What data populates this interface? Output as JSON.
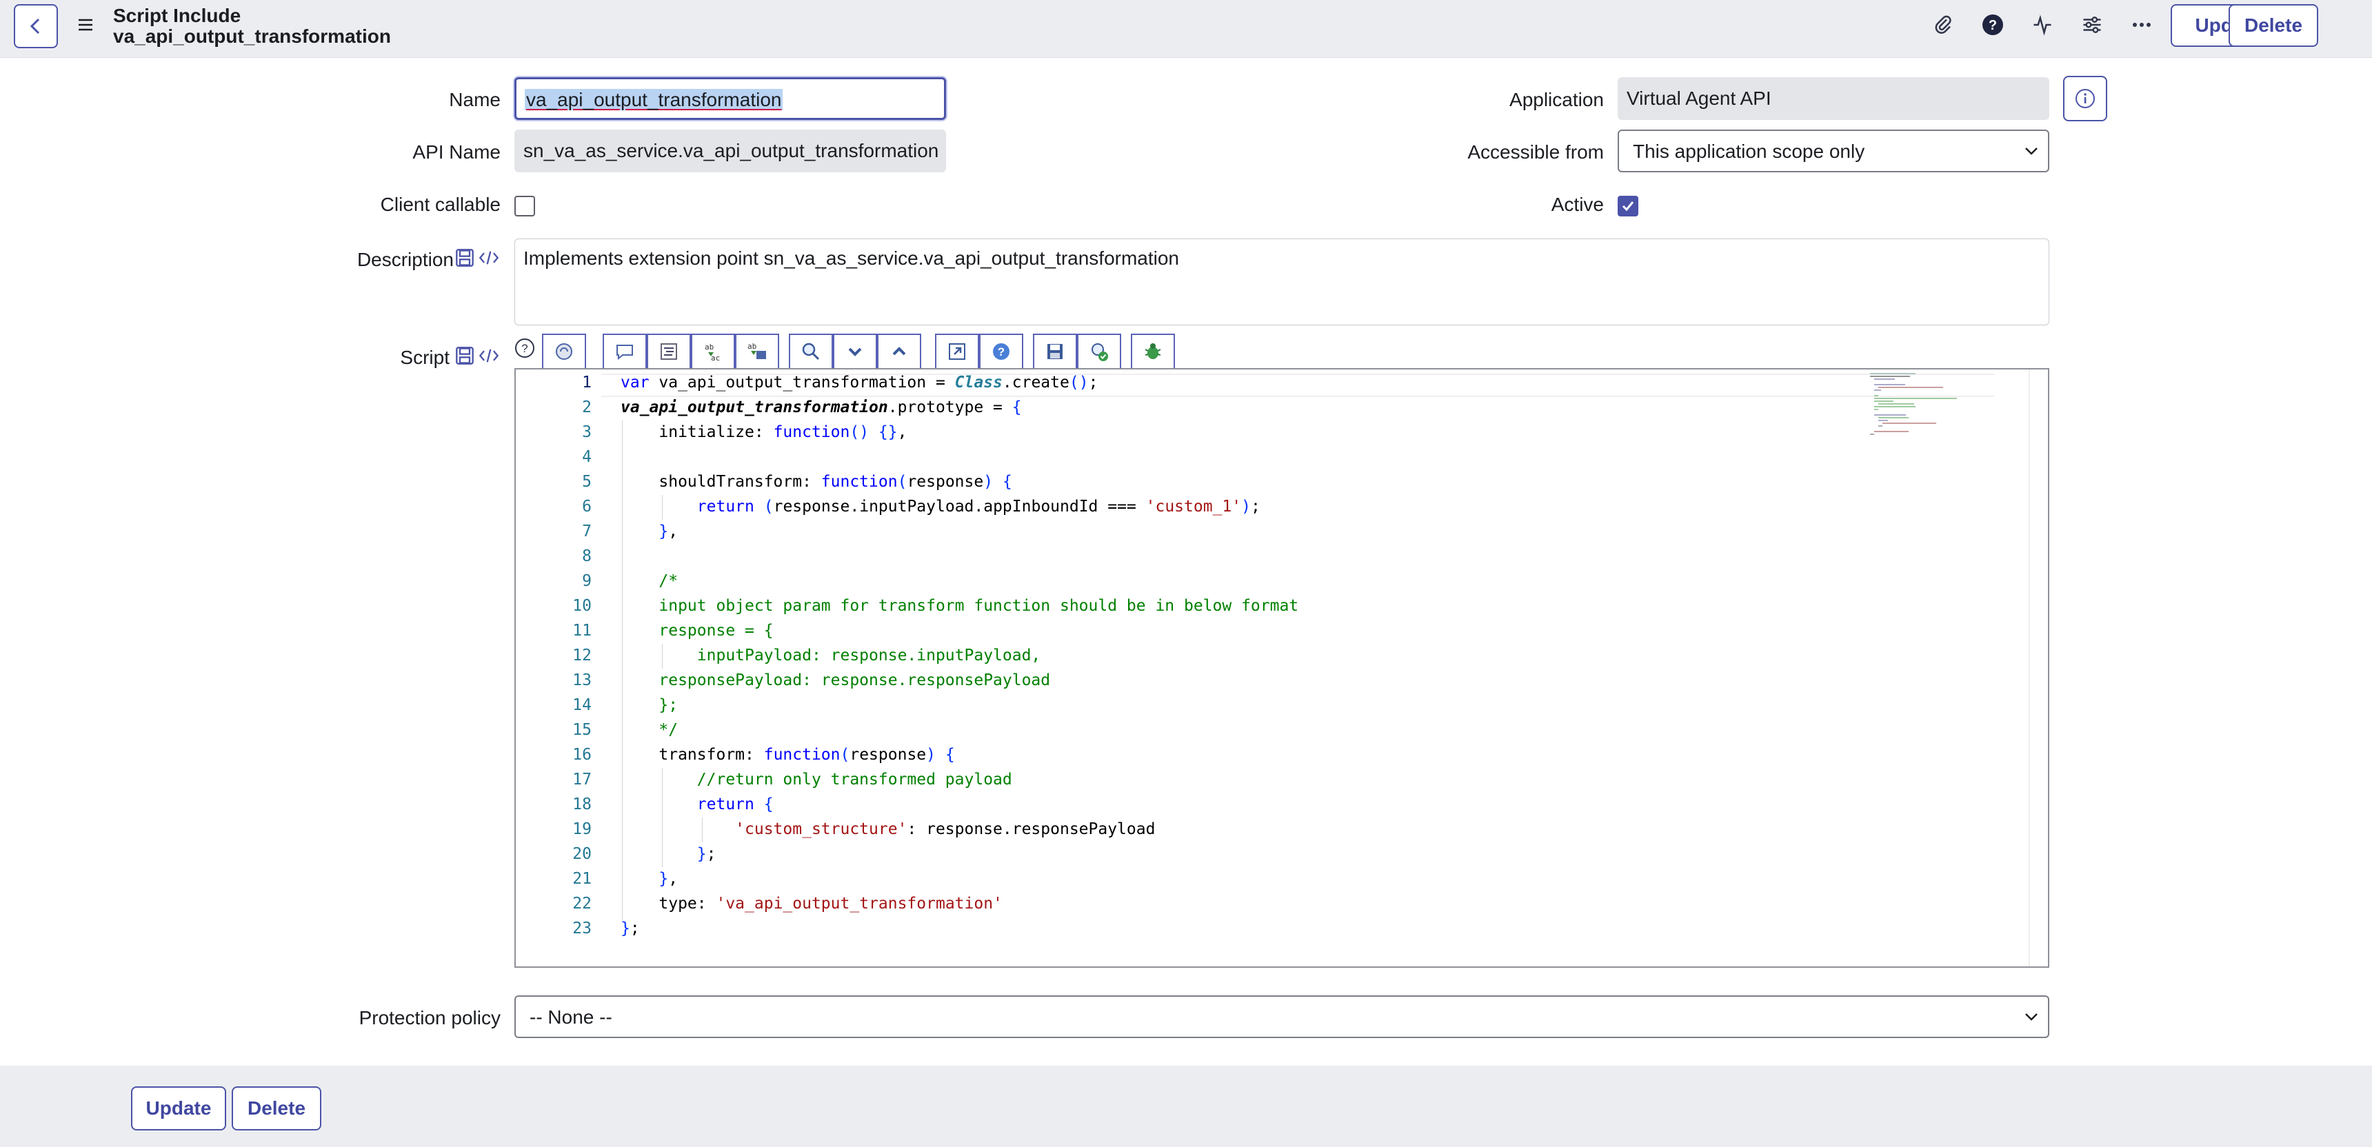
{
  "header": {
    "record_type": "Script Include",
    "record_name": "va_api_output_transformation",
    "update_label": "Update",
    "delete_label": "Delete"
  },
  "form": {
    "name_label": "Name",
    "name_value": "va_api_output_transformation",
    "api_name_label": "API Name",
    "api_name_value": "sn_va_as_service.va_api_output_transformation",
    "client_callable_label": "Client callable",
    "client_callable_checked": false,
    "description_label": "Description",
    "description_value": "Implements extension point sn_va_as_service.va_api_output_transformation",
    "script_label": "Script",
    "application_label": "Application",
    "application_value": "Virtual Agent API",
    "accessible_from_label": "Accessible from",
    "accessible_from_value": "This application scope only",
    "active_label": "Active",
    "active_checked": true,
    "protection_policy_label": "Protection policy",
    "protection_policy_value": "-- None --"
  },
  "script": {
    "line_numbers": [
      "1",
      "2",
      "3",
      "4",
      "5",
      "6",
      "7",
      "8",
      "9",
      "10",
      "11",
      "12",
      "13",
      "14",
      "15",
      "16",
      "17",
      "18",
      "19",
      "20",
      "21",
      "22",
      "23"
    ],
    "lines": [
      "var va_api_output_transformation = Class.create();",
      "va_api_output_transformation.prototype = {",
      "    initialize: function() {},",
      "",
      "    shouldTransform: function(response) {",
      "        return (response.inputPayload.appInboundId === 'custom_1');",
      "    },",
      "",
      "    /*",
      "    input object param for transform function should be in below format",
      "    response = {",
      "        inputPayload: response.inputPayload,",
      "    responsePayload: response.responsePayload",
      "    };",
      "    */",
      "    transform: function(response) {",
      "        //return only transformed payload",
      "        return {",
      "            'custom_structure': response.responsePayload",
      "        };",
      "    },",
      "    type: 'va_api_output_transformation'",
      "};"
    ]
  },
  "footer": {
    "update_label": "Update",
    "delete_label": "Delete"
  },
  "icons": {
    "back": "chevron-left-icon",
    "menu": "hamburger-menu-icon",
    "attachment": "paperclip-icon",
    "help": "question-circle-icon",
    "activity": "pulse-icon",
    "settings": "sliders-icon",
    "more": "ellipsis-icon",
    "info": "info-icon"
  },
  "colors": {
    "accent": "#4b53a8",
    "header_bg": "#ecedf1",
    "keyword": "#0000ff",
    "string": "#a31515",
    "comment": "#008000"
  }
}
